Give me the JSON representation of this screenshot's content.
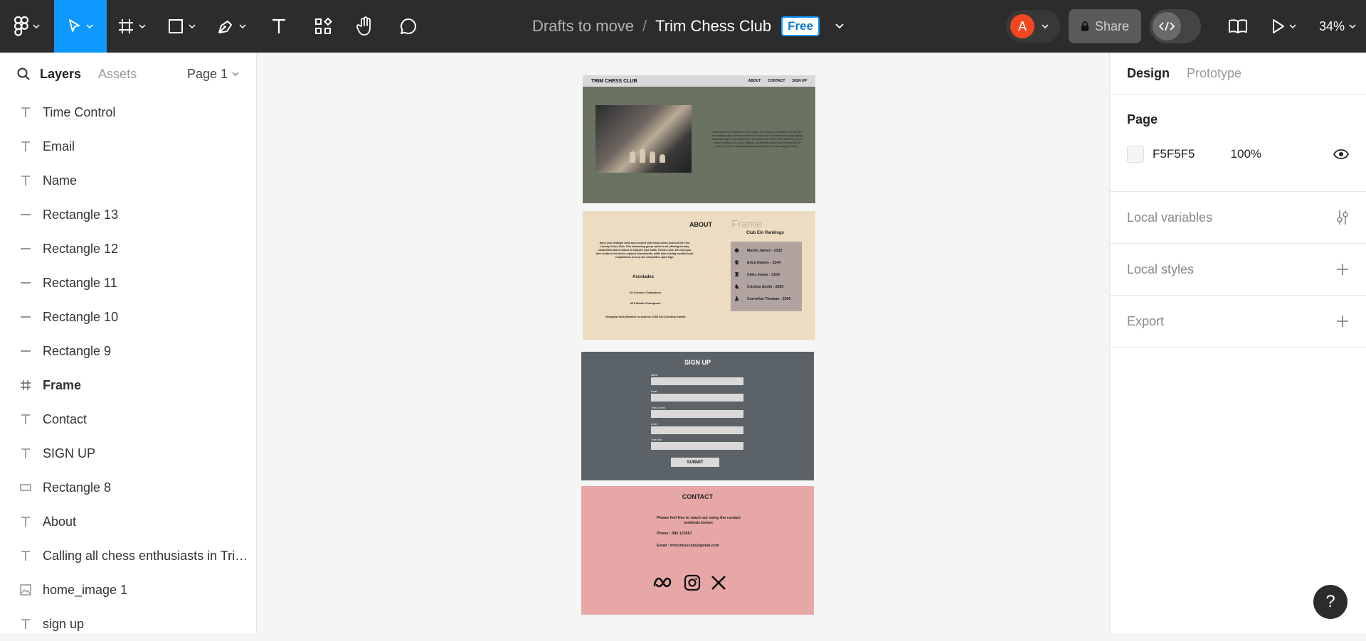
{
  "toolbar": {
    "tools": [
      "figma-menu",
      "move",
      "frame",
      "shape",
      "pen",
      "text",
      "components",
      "hand",
      "comment"
    ],
    "active_tool": "move"
  },
  "breadcrumb": {
    "folder": "Drafts to move",
    "separator": "/",
    "file": "Trim Chess Club",
    "plan_badge": "Free"
  },
  "header_right": {
    "avatar_initial": "A",
    "share_label": "Share",
    "zoom": "34%"
  },
  "left_panel": {
    "tab_layers": "Layers",
    "tab_assets": "Assets",
    "page_selector": "Page 1",
    "layers": [
      {
        "type": "text",
        "name": "Time Control"
      },
      {
        "type": "text",
        "name": "Email"
      },
      {
        "type": "text",
        "name": "Name"
      },
      {
        "type": "line",
        "name": "Rectangle 13"
      },
      {
        "type": "line",
        "name": "Rectangle 12"
      },
      {
        "type": "line",
        "name": "Rectangle 11"
      },
      {
        "type": "line",
        "name": "Rectangle 10"
      },
      {
        "type": "line",
        "name": "Rectangle 9"
      },
      {
        "type": "frame",
        "name": "Frame"
      },
      {
        "type": "text",
        "name": "Contact"
      },
      {
        "type": "text",
        "name": "SIGN UP"
      },
      {
        "type": "rect",
        "name": "Rectangle 8"
      },
      {
        "type": "text",
        "name": "About"
      },
      {
        "type": "text",
        "name": "Calling all chess enthusiasts in Trim..."
      },
      {
        "type": "image",
        "name": "home_image 1"
      },
      {
        "type": "text",
        "name": "sign up"
      }
    ]
  },
  "right_panel": {
    "tab_design": "Design",
    "tab_prototype": "Prototype",
    "page_heading": "Page",
    "page_color": "F5F5F5",
    "page_opacity": "100%",
    "local_variables": "Local variables",
    "local_styles": "Local styles",
    "export": "Export"
  },
  "help_label": "?",
  "canvas": {
    "home": {
      "brand": "TRIM CHESS CLUB",
      "nav": [
        "ABOUT",
        "CONTACT",
        "SIGN UP"
      ],
      "blurb": "Calling all chess enthusiasts in Trim! Gather at the heart of the historic town and test your strategic skills at the vast of the Trim Chess Club. This friendly but highly-fighting welcomes players of all skill levels to the historic Trim Chess Club. Whether you're a seasoned player or a curious beginner, our members gather here to share and the game of a chess. Unparallel passionate about the timeless strategy of chess."
    },
    "about": {
      "heading": "ABOUT",
      "body": "Hone your strategic mind and connect with fellow chess lovers at the Trim Literary Chess Club. This welcoming group caters to all, offering friendly competitive and a chance to sharpen your skills. Throw a year, the club puts their mettle to the test in regional tournaments, while also hosting monthly local competitions to keep the competitive spirit high.",
      "accolades_title": "Accolades",
      "accolades": [
        "2X Leinster Champions",
        "U15 Meath Champions",
        "Youngest Irish Member to achieve 2000 Elo (Cristina Smith)"
      ],
      "frame_label": "Frame",
      "rankings_title": "Club Elo Rankings",
      "rankings": [
        {
          "glyph": "♚",
          "text": "Martin James - 2332"
        },
        {
          "glyph": "♛",
          "text": "Erica Daives - 2244"
        },
        {
          "glyph": "♜",
          "text": "Chris Jones - 2100"
        },
        {
          "glyph": "♞",
          "text": "Cristina Smith - 2050"
        },
        {
          "glyph": "♟",
          "text": "Cornelius Thomas - 2000"
        }
      ]
    },
    "signup": {
      "heading": "SIGN UP",
      "fields": [
        "Name",
        "Email",
        "Time Control",
        "Level",
        "Time Slot"
      ],
      "submit": "SUBMIT"
    },
    "contact": {
      "heading": "CONTACT",
      "intro": "Please feel free to reach out using the contact methods below:",
      "phone": "Phone : 085 123567",
      "email": "Email : trimchessclub@gmail.com",
      "socials": [
        "meta-icon",
        "instagram-icon",
        "x-icon"
      ]
    }
  }
}
